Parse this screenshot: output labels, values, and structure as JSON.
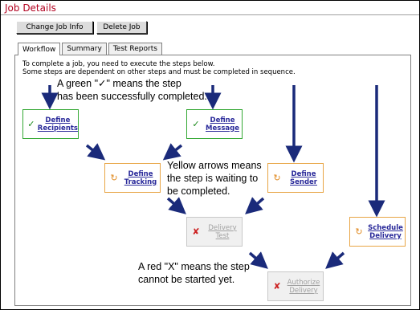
{
  "page": {
    "title": "Job Details"
  },
  "toolbar": {
    "change_job_info_label": "Change Job Info",
    "delete_job_label": "Delete Job"
  },
  "tabs": [
    {
      "label": "Workflow",
      "active": true
    },
    {
      "label": "Summary",
      "active": false
    },
    {
      "label": "Test Reports",
      "active": false
    }
  ],
  "instructions": {
    "line1": "To complete a job, you need to execute the steps below.",
    "line2": "Some steps are dependent on other steps and must be completed in sequence."
  },
  "steps": {
    "define_recipients": {
      "line1": "Define",
      "line2": "Recipients",
      "status": "completed",
      "icon": "check-icon"
    },
    "define_message": {
      "line1": "Define",
      "line2": "Message",
      "status": "completed",
      "icon": "check-icon"
    },
    "define_tracking": {
      "line1": "Define",
      "line2": "Tracking",
      "status": "waiting",
      "icon": "waiting-icon"
    },
    "define_sender": {
      "line1": "Define",
      "line2": "Sender",
      "status": "waiting",
      "icon": "waiting-icon"
    },
    "delivery_test": {
      "line1": "Delivery",
      "line2": "Test",
      "status": "blocked",
      "icon": "x-icon"
    },
    "schedule_delivery": {
      "line1": "Schedule",
      "line2": "Delivery",
      "status": "waiting",
      "icon": "waiting-icon"
    },
    "authorize_delivery": {
      "line1": "Authorize",
      "line2": "Delivery",
      "status": "blocked",
      "icon": "x-icon"
    }
  },
  "glyphs": {
    "check": "✓",
    "waiting": "↻",
    "x": "✘"
  },
  "callouts": {
    "green": {
      "line1": "A green \"✓\" means the step",
      "line2": "has been successfully completed."
    },
    "yellow": {
      "line1": "Yellow arrows means",
      "line2": "the step is waiting to",
      "line3": "be completed."
    },
    "red": {
      "line1": "A red \"X\" means the step",
      "line2": "cannot be started yet."
    }
  },
  "colors": {
    "title": "#b2001f",
    "completed_border": "#33a833",
    "waiting_border": "#e8a545",
    "blocked_border": "#c8c8c8",
    "arrow": "#1a2a7a",
    "link": "#2a2a9a"
  }
}
